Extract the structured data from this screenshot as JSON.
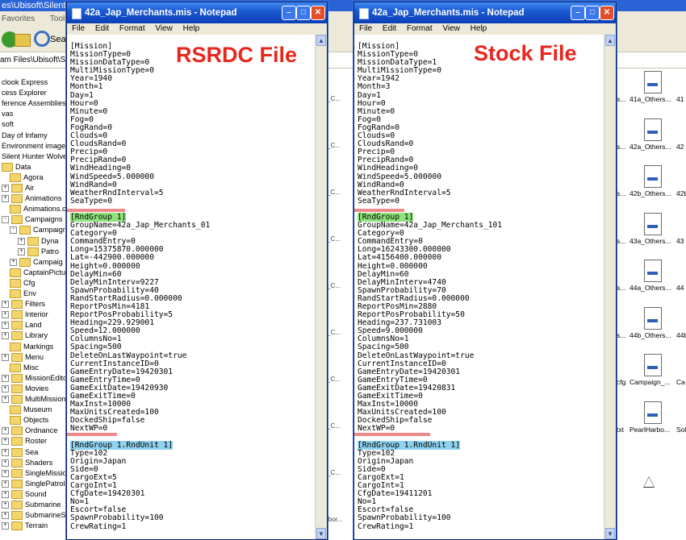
{
  "explorer": {
    "title": "es\\Ubisoft\\Silent",
    "menu": [
      "Favorites",
      "Tools"
    ],
    "search_label": "Sea",
    "address": "am Files\\Ubisoft\\Silent",
    "tree": [
      {
        "label": "clook Express",
        "indent": 0,
        "expander": "",
        "folder": false
      },
      {
        "label": "cess Explorer",
        "indent": 0,
        "expander": "",
        "folder": false
      },
      {
        "label": "ference Assemblies",
        "indent": 0,
        "expander": "",
        "folder": false
      },
      {
        "label": "vas",
        "indent": 0,
        "expander": "",
        "folder": false
      },
      {
        "label": "soft",
        "indent": 0,
        "expander": "",
        "folder": false
      },
      {
        "label": "Day of Infamy",
        "indent": 0,
        "expander": "",
        "folder": false
      },
      {
        "label": "Environment images",
        "indent": 0,
        "expander": "",
        "folder": false
      },
      {
        "label": "Silent Hunter Wolves",
        "indent": 0,
        "expander": "",
        "folder": false
      },
      {
        "label": "Data",
        "indent": 0,
        "expander": "",
        "folder": true
      },
      {
        "label": "Agora",
        "indent": 1,
        "expander": "",
        "folder": true
      },
      {
        "label": "Air",
        "indent": 0,
        "expander": "+",
        "folder": true
      },
      {
        "label": "Animations",
        "indent": 0,
        "expander": "+",
        "folder": true
      },
      {
        "label": "Animations.o",
        "indent": 1,
        "expander": "",
        "folder": true
      },
      {
        "label": "Campaigns",
        "indent": 0,
        "expander": "-",
        "folder": true
      },
      {
        "label": "Campaign",
        "indent": 1,
        "expander": "-",
        "folder": true
      },
      {
        "label": "Dyna",
        "indent": 2,
        "expander": "+",
        "folder": true
      },
      {
        "label": "Patro",
        "indent": 2,
        "expander": "+",
        "folder": true
      },
      {
        "label": "Campaig",
        "indent": 1,
        "expander": "+",
        "folder": true
      },
      {
        "label": "CaptainPictur",
        "indent": 1,
        "expander": "",
        "folder": true
      },
      {
        "label": "Cfg",
        "indent": 1,
        "expander": "",
        "folder": true
      },
      {
        "label": "Env",
        "indent": 1,
        "expander": "",
        "folder": true
      },
      {
        "label": "Filters",
        "indent": 0,
        "expander": "+",
        "folder": true
      },
      {
        "label": "Interior",
        "indent": 0,
        "expander": "+",
        "folder": true
      },
      {
        "label": "Land",
        "indent": 0,
        "expander": "+",
        "folder": true
      },
      {
        "label": "Library",
        "indent": 0,
        "expander": "+",
        "folder": true
      },
      {
        "label": "Markings",
        "indent": 1,
        "expander": "",
        "folder": true
      },
      {
        "label": "Menu",
        "indent": 0,
        "expander": "+",
        "folder": true
      },
      {
        "label": "Misc",
        "indent": 1,
        "expander": "",
        "folder": true
      },
      {
        "label": "MissionEditor",
        "indent": 0,
        "expander": "+",
        "folder": true
      },
      {
        "label": "Movies",
        "indent": 0,
        "expander": "+",
        "folder": true
      },
      {
        "label": "MultiMissions",
        "indent": 0,
        "expander": "+",
        "folder": true
      },
      {
        "label": "Museum",
        "indent": 1,
        "expander": "",
        "folder": true
      },
      {
        "label": "Objects",
        "indent": 1,
        "expander": "",
        "folder": true
      },
      {
        "label": "Ordnance",
        "indent": 0,
        "expander": "+",
        "folder": true
      },
      {
        "label": "Roster",
        "indent": 0,
        "expander": "+",
        "folder": true
      },
      {
        "label": "Sea",
        "indent": 0,
        "expander": "+",
        "folder": true
      },
      {
        "label": "Shaders",
        "indent": 0,
        "expander": "+",
        "folder": true
      },
      {
        "label": "SingleMission",
        "indent": 0,
        "expander": "+",
        "folder": true
      },
      {
        "label": "SinglePatrols",
        "indent": 0,
        "expander": "+",
        "folder": true
      },
      {
        "label": "Sound",
        "indent": 0,
        "expander": "+",
        "folder": true
      },
      {
        "label": "Submarine",
        "indent": 0,
        "expander": "+",
        "folder": true
      },
      {
        "label": "SubmarineSc",
        "indent": 0,
        "expander": "+",
        "folder": true
      },
      {
        "label": "Terrain",
        "indent": 0,
        "expander": "+",
        "folder": true
      }
    ],
    "files": [
      {
        "left": "s...",
        "name": "41a_Others...",
        "right": "41"
      },
      {
        "left": "s...",
        "name": "42a_Others...",
        "right": "42"
      },
      {
        "left": "s...",
        "name": "42b_Others...",
        "right": "42b"
      },
      {
        "left": "s...",
        "name": "43a_Others...",
        "right": "43"
      },
      {
        "left": "s...",
        "name": "44a_Others...",
        "right": "44"
      },
      {
        "left": "s...",
        "name": "44b_Others...",
        "right": "44b"
      },
      {
        "left": "cfg",
        "name": "Campaign_...",
        "right": "Ca"
      },
      {
        "left": "txt",
        "name": "PearlHarbo...",
        "right": "Sol"
      }
    ],
    "between_labels": [
      "_C...",
      "_C...",
      "_C...",
      "_C...",
      "_C...",
      "_C...",
      "_C...",
      "_C...",
      "_C...",
      "ibor..."
    ]
  },
  "windows": [
    {
      "id": "rsrdc",
      "title": "42a_Jap_Merchants.mis - Notepad",
      "menu": [
        "File",
        "Edit",
        "Format",
        "View",
        "Help"
      ],
      "overlay_label": "RSRDC File",
      "lines": [
        "[Mission]",
        "MissionType=0",
        "MissionDataType=0",
        "MultiMissionType=0",
        "Year=1940",
        "Month=1",
        "Day=1",
        "Hour=0",
        "Minute=0",
        "Fog=0",
        "FogRand=0",
        "Clouds=0",
        "CloudsRand=0",
        "Precip=0",
        "PrecipRand=0",
        "WindHeading=0",
        "WindSpeed=5.000000",
        "WindRand=0",
        "WeatherRndInterval=5",
        "SeaType=0",
        "",
        "[RndGroup 1]",
        "GroupName=42a_Jap_Merchants_01",
        "Category=0",
        "CommandEntry=0",
        "Long=15375870.000000",
        "Lat=-442900.000000",
        "Height=0.000000",
        "DelayMin=60",
        "DelayMinInterv=9227",
        "SpawnProbability=40",
        "RandStartRadius=0.000000",
        "ReportPosMin=4181",
        "ReportPosProbability=5",
        "Heading=229.929001",
        "Speed=12.000000",
        "ColumnsNo=1",
        "Spacing=500",
        "DeleteOnLastWaypoint=true",
        "CurrentInstanceID=0",
        "GameEntryDate=19420301",
        "GameEntryTime=0",
        "GameExitDate=19420930",
        "GameExitTime=0",
        "MaxInst=10000",
        "MaxUnitsCreated=100",
        "DockedShip=false",
        "NextWP=0",
        "",
        "[RndGroup 1.RndUnit 1]",
        "Type=102",
        "Origin=Japan",
        "Side=0",
        "CargoExt=5",
        "CargoInt=1",
        "CfgDate=19420301",
        "No=1",
        "Escort=false",
        "SpawnProbability=100",
        "CrewRating=1"
      ]
    },
    {
      "id": "stock",
      "title": "42a_Jap_Merchants.mis - Notepad",
      "menu": [
        "File",
        "Edit",
        "Format",
        "View",
        "Help"
      ],
      "overlay_label": "Stock File",
      "lines": [
        "[Mission]",
        "MissionType=0",
        "MissionDataType=1",
        "MultiMissionType=0",
        "Year=1942",
        "Month=3",
        "Day=1",
        "Hour=0",
        "Minute=0",
        "Fog=0",
        "FogRand=0",
        "Clouds=0",
        "CloudsRand=0",
        "Precip=0",
        "PrecipRand=0",
        "WindHeading=0",
        "WindSpeed=5.000000",
        "WindRand=0",
        "WeatherRndInterval=5",
        "SeaType=0",
        "",
        "[RndGroup 1]",
        "GroupName=42a_Jap_Merchants_101",
        "Category=0",
        "CommandEntry=0",
        "Long=16243300.000000",
        "Lat=4156400.000000",
        "Height=0.000000",
        "DelayMin=60",
        "DelayMinInterv=4740",
        "SpawnProbability=70",
        "RandStartRadius=0.000000",
        "ReportPosMin=2880",
        "ReportPosProbability=50",
        "Heading=237.731003",
        "Speed=9.000000",
        "ColumnsNo=1",
        "Spacing=500",
        "DeleteOnLastWaypoint=true",
        "CurrentInstanceID=0",
        "GameEntryDate=19420301",
        "GameEntryTime=0",
        "GameExitDate=19420831",
        "GameExitTime=0",
        "MaxInst=10000",
        "MaxUnitsCreated=100",
        "DockedShip=false",
        "NextWP=0",
        "",
        "[RndGroup 1.RndUnit 1]",
        "Type=102",
        "Origin=Japan",
        "Side=0",
        "CargoExt=1",
        "CargoInt=1",
        "CfgDate=19411201",
        "No=1",
        "Escort=false",
        "SpawnProbability=100",
        "CrewRating=1"
      ]
    }
  ]
}
